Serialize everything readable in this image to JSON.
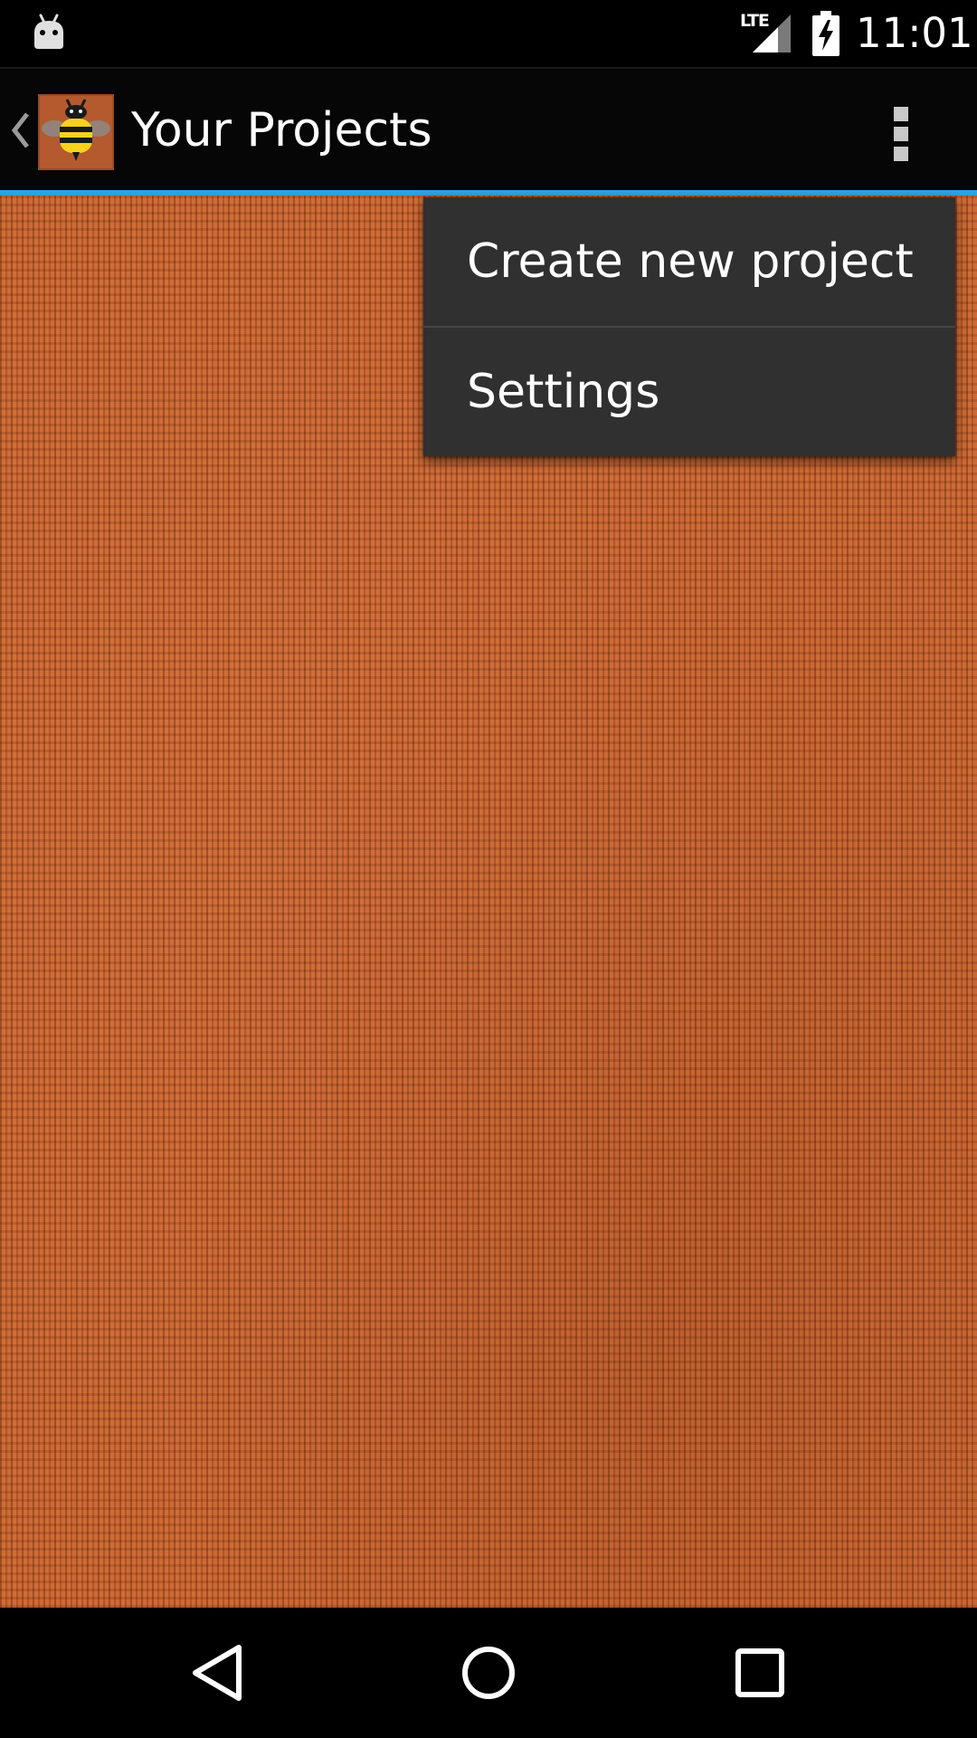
{
  "status_bar": {
    "network_label": "LTE",
    "time": "11:01",
    "icons": {
      "notification": "android-robot-icon",
      "signal": "cell-signal-icon",
      "battery": "battery-charging-icon"
    }
  },
  "action_bar": {
    "title": "Your Projects",
    "icons": {
      "up": "chevron-left-icon",
      "logo": "bee-logo-icon",
      "overflow": "overflow-menu-icon"
    },
    "colors": {
      "underline": "#2ea3d6",
      "background": "#060606"
    }
  },
  "overflow_menu": {
    "items": [
      {
        "label": "Create new project"
      },
      {
        "label": "Settings"
      }
    ],
    "colors": {
      "background": "#303030"
    }
  },
  "background": {
    "texture": "orange-knit",
    "color": "#c2612c"
  },
  "nav_bar": {
    "icons": {
      "back": "back-triangle-icon",
      "home": "home-circle-icon",
      "recents": "recents-square-icon"
    }
  }
}
